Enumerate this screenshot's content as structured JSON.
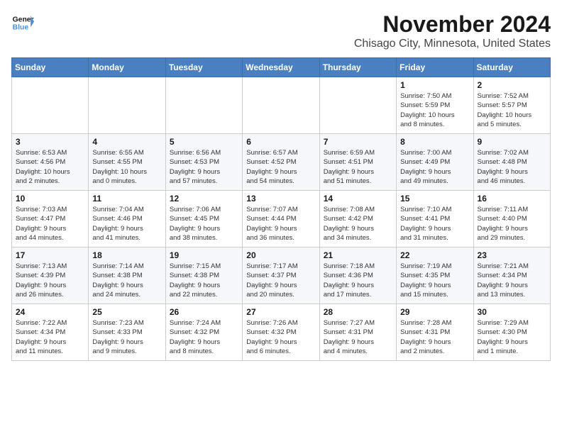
{
  "header": {
    "logo_line1": "General",
    "logo_line2": "Blue",
    "month_title": "November 2024",
    "location": "Chisago City, Minnesota, United States"
  },
  "weekdays": [
    "Sunday",
    "Monday",
    "Tuesday",
    "Wednesday",
    "Thursday",
    "Friday",
    "Saturday"
  ],
  "weeks": [
    [
      {
        "day": "",
        "info": ""
      },
      {
        "day": "",
        "info": ""
      },
      {
        "day": "",
        "info": ""
      },
      {
        "day": "",
        "info": ""
      },
      {
        "day": "",
        "info": ""
      },
      {
        "day": "1",
        "info": "Sunrise: 7:50 AM\nSunset: 5:59 PM\nDaylight: 10 hours\nand 8 minutes."
      },
      {
        "day": "2",
        "info": "Sunrise: 7:52 AM\nSunset: 5:57 PM\nDaylight: 10 hours\nand 5 minutes."
      }
    ],
    [
      {
        "day": "3",
        "info": "Sunrise: 6:53 AM\nSunset: 4:56 PM\nDaylight: 10 hours\nand 2 minutes."
      },
      {
        "day": "4",
        "info": "Sunrise: 6:55 AM\nSunset: 4:55 PM\nDaylight: 10 hours\nand 0 minutes."
      },
      {
        "day": "5",
        "info": "Sunrise: 6:56 AM\nSunset: 4:53 PM\nDaylight: 9 hours\nand 57 minutes."
      },
      {
        "day": "6",
        "info": "Sunrise: 6:57 AM\nSunset: 4:52 PM\nDaylight: 9 hours\nand 54 minutes."
      },
      {
        "day": "7",
        "info": "Sunrise: 6:59 AM\nSunset: 4:51 PM\nDaylight: 9 hours\nand 51 minutes."
      },
      {
        "day": "8",
        "info": "Sunrise: 7:00 AM\nSunset: 4:49 PM\nDaylight: 9 hours\nand 49 minutes."
      },
      {
        "day": "9",
        "info": "Sunrise: 7:02 AM\nSunset: 4:48 PM\nDaylight: 9 hours\nand 46 minutes."
      }
    ],
    [
      {
        "day": "10",
        "info": "Sunrise: 7:03 AM\nSunset: 4:47 PM\nDaylight: 9 hours\nand 44 minutes."
      },
      {
        "day": "11",
        "info": "Sunrise: 7:04 AM\nSunset: 4:46 PM\nDaylight: 9 hours\nand 41 minutes."
      },
      {
        "day": "12",
        "info": "Sunrise: 7:06 AM\nSunset: 4:45 PM\nDaylight: 9 hours\nand 38 minutes."
      },
      {
        "day": "13",
        "info": "Sunrise: 7:07 AM\nSunset: 4:44 PM\nDaylight: 9 hours\nand 36 minutes."
      },
      {
        "day": "14",
        "info": "Sunrise: 7:08 AM\nSunset: 4:42 PM\nDaylight: 9 hours\nand 34 minutes."
      },
      {
        "day": "15",
        "info": "Sunrise: 7:10 AM\nSunset: 4:41 PM\nDaylight: 9 hours\nand 31 minutes."
      },
      {
        "day": "16",
        "info": "Sunrise: 7:11 AM\nSunset: 4:40 PM\nDaylight: 9 hours\nand 29 minutes."
      }
    ],
    [
      {
        "day": "17",
        "info": "Sunrise: 7:13 AM\nSunset: 4:39 PM\nDaylight: 9 hours\nand 26 minutes."
      },
      {
        "day": "18",
        "info": "Sunrise: 7:14 AM\nSunset: 4:38 PM\nDaylight: 9 hours\nand 24 minutes."
      },
      {
        "day": "19",
        "info": "Sunrise: 7:15 AM\nSunset: 4:38 PM\nDaylight: 9 hours\nand 22 minutes."
      },
      {
        "day": "20",
        "info": "Sunrise: 7:17 AM\nSunset: 4:37 PM\nDaylight: 9 hours\nand 20 minutes."
      },
      {
        "day": "21",
        "info": "Sunrise: 7:18 AM\nSunset: 4:36 PM\nDaylight: 9 hours\nand 17 minutes."
      },
      {
        "day": "22",
        "info": "Sunrise: 7:19 AM\nSunset: 4:35 PM\nDaylight: 9 hours\nand 15 minutes."
      },
      {
        "day": "23",
        "info": "Sunrise: 7:21 AM\nSunset: 4:34 PM\nDaylight: 9 hours\nand 13 minutes."
      }
    ],
    [
      {
        "day": "24",
        "info": "Sunrise: 7:22 AM\nSunset: 4:34 PM\nDaylight: 9 hours\nand 11 minutes."
      },
      {
        "day": "25",
        "info": "Sunrise: 7:23 AM\nSunset: 4:33 PM\nDaylight: 9 hours\nand 9 minutes."
      },
      {
        "day": "26",
        "info": "Sunrise: 7:24 AM\nSunset: 4:32 PM\nDaylight: 9 hours\nand 8 minutes."
      },
      {
        "day": "27",
        "info": "Sunrise: 7:26 AM\nSunset: 4:32 PM\nDaylight: 9 hours\nand 6 minutes."
      },
      {
        "day": "28",
        "info": "Sunrise: 7:27 AM\nSunset: 4:31 PM\nDaylight: 9 hours\nand 4 minutes."
      },
      {
        "day": "29",
        "info": "Sunrise: 7:28 AM\nSunset: 4:31 PM\nDaylight: 9 hours\nand 2 minutes."
      },
      {
        "day": "30",
        "info": "Sunrise: 7:29 AM\nSunset: 4:30 PM\nDaylight: 9 hours\nand 1 minute."
      }
    ]
  ]
}
